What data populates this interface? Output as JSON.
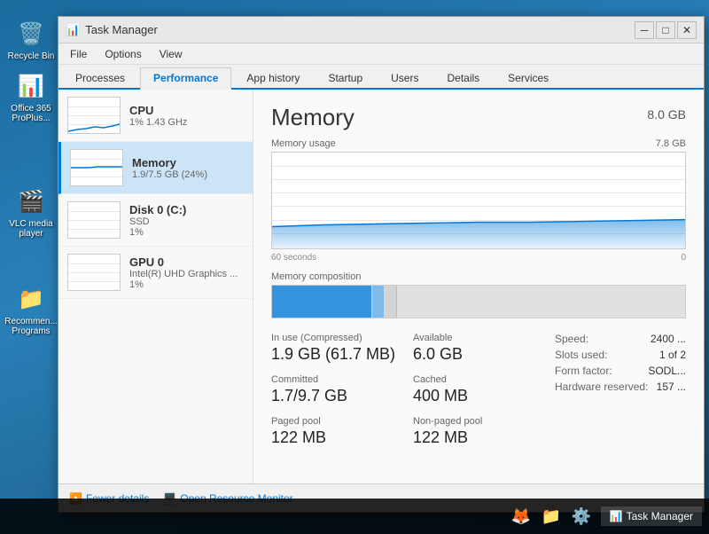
{
  "desktop": {
    "icons": [
      {
        "id": "recycle-bin",
        "label": "Recycle Bin",
        "emoji": "🗑️"
      },
      {
        "id": "office365",
        "label": "Office 365 ProPlus...",
        "emoji": "📊"
      },
      {
        "id": "vlc",
        "label": "VLC media player",
        "emoji": "🎬"
      },
      {
        "id": "programs",
        "label": "Recommen... Programs",
        "emoji": "📁"
      }
    ]
  },
  "window": {
    "title": "Task Manager",
    "menu_items": [
      "File",
      "Options",
      "View"
    ],
    "tabs": [
      "Processes",
      "Performance",
      "App history",
      "Startup",
      "Users",
      "Details",
      "Services"
    ],
    "active_tab": "Performance"
  },
  "sidebar": {
    "items": [
      {
        "id": "cpu",
        "name": "CPU",
        "detail1": "1%  1.43 GHz",
        "detail2": "",
        "active": false
      },
      {
        "id": "memory",
        "name": "Memory",
        "detail1": "1.9/7.5 GB (24%)",
        "detail2": "",
        "active": true
      },
      {
        "id": "disk",
        "name": "Disk 0 (C:)",
        "detail1": "SSD",
        "detail2": "1%",
        "active": false
      },
      {
        "id": "gpu",
        "name": "GPU 0",
        "detail1": "Intel(R) UHD Graphics ...",
        "detail2": "1%",
        "active": false
      }
    ]
  },
  "content": {
    "title": "Memory",
    "total": "8.0 GB",
    "chart": {
      "label": "Memory usage",
      "max_label": "7.8 GB",
      "time_left": "60 seconds",
      "time_right": "0"
    },
    "composition_label": "Memory composition",
    "stats": {
      "in_use_label": "In use (Compressed)",
      "in_use_value": "1.9 GB (61.7 MB)",
      "available_label": "Available",
      "available_value": "6.0 GB",
      "committed_label": "Committed",
      "committed_value": "1.7/9.7 GB",
      "cached_label": "Cached",
      "cached_value": "400 MB",
      "paged_pool_label": "Paged pool",
      "paged_pool_value": "122 MB",
      "non_paged_label": "Non-paged pool",
      "non_paged_value": "122 MB"
    },
    "right_stats": {
      "speed_label": "Speed:",
      "speed_value": "2400 ...",
      "slots_label": "Slots used:",
      "slots_value": "1 of 2",
      "form_label": "Form factor:",
      "form_value": "SODL...",
      "hw_reserved_label": "Hardware reserved:",
      "hw_reserved_value": "157 ..."
    }
  },
  "bottom": {
    "fewer_details": "Fewer details",
    "open_monitor": "Open Resource Monitor"
  },
  "taskbar": {
    "apps": [
      {
        "id": "task-manager",
        "label": "Task Manager",
        "emoji": "📊"
      }
    ],
    "icons": [
      "🦊",
      "📁",
      "⚙️"
    ]
  }
}
